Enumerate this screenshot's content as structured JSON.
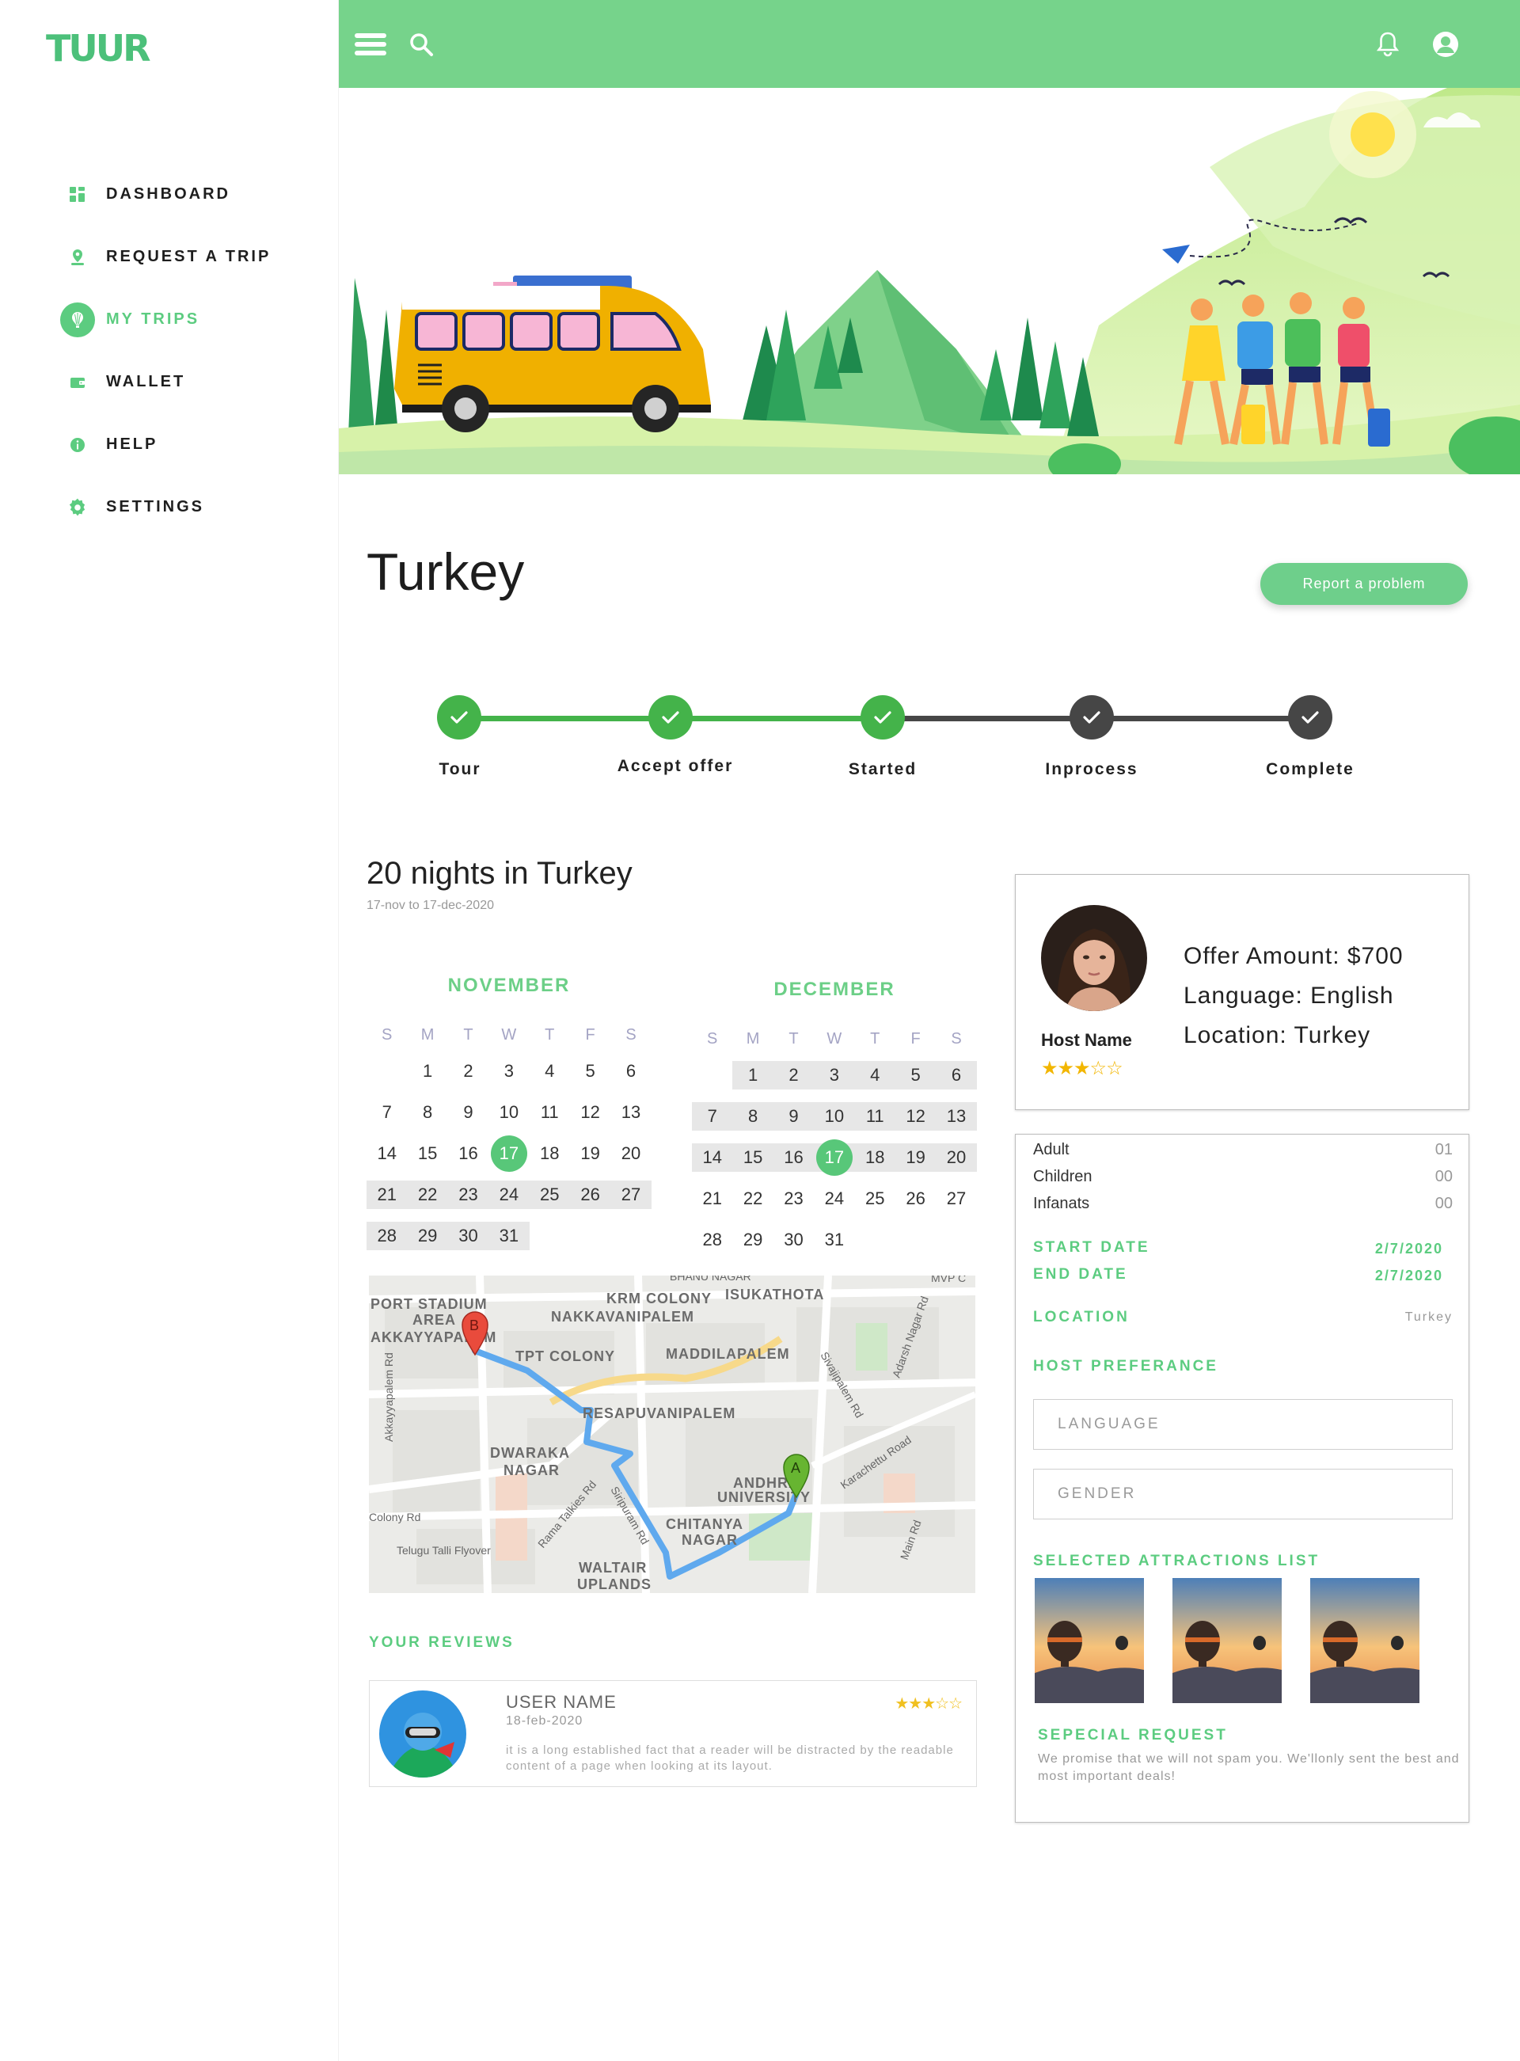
{
  "app": {
    "logo": "TUUR"
  },
  "sidebar": {
    "items": [
      {
        "label": "DASHBOARD",
        "icon": "dashboard-icon",
        "active": false
      },
      {
        "label": "REQUEST A TRIP",
        "icon": "map-pin-icon",
        "active": false
      },
      {
        "label": "MY TRIPS",
        "icon": "balloon-icon",
        "active": true
      },
      {
        "label": "WALLET",
        "icon": "wallet-icon",
        "active": false
      },
      {
        "label": "HELP",
        "icon": "info-icon",
        "active": false
      },
      {
        "label": "SETTINGS",
        "icon": "gear-icon",
        "active": false
      }
    ]
  },
  "topbar": {
    "menu_icon": "hamburger-icon",
    "search_icon": "search-icon",
    "bell_icon": "bell-icon",
    "user_icon": "user-icon"
  },
  "page": {
    "title": "Turkey",
    "report_label": "Report a problem"
  },
  "progress": {
    "steps": [
      {
        "label": "Tour",
        "done": true
      },
      {
        "label": "Accept offer",
        "done": true
      },
      {
        "label": "Started",
        "done": true
      },
      {
        "label": "Inprocess",
        "done": false
      },
      {
        "label": "Complete",
        "done": false
      }
    ]
  },
  "trip": {
    "title": "20 nights in Turkey",
    "dates": "17-nov to 17-dec-2020"
  },
  "calendars": [
    {
      "month": "NOVEMBER",
      "weekdays": [
        "S",
        "M",
        "T",
        "W",
        "T",
        "F",
        "S"
      ],
      "weeks": [
        [
          "",
          "1",
          "2",
          "3",
          "4",
          "5",
          "6"
        ],
        [
          "7",
          "8",
          "9",
          "10",
          "11",
          "12",
          "13"
        ],
        [
          "14",
          "15",
          "16",
          "17",
          "18",
          "19",
          "20"
        ],
        [
          "21",
          "22",
          "23",
          "24",
          "25",
          "26",
          "27"
        ],
        [
          "28",
          "29",
          "30",
          "31",
          "",
          "",
          ""
        ]
      ],
      "selected": "17"
    },
    {
      "month": "DECEMBER",
      "weekdays": [
        "S",
        "M",
        "T",
        "W",
        "T",
        "F",
        "S"
      ],
      "weeks": [
        [
          "",
          "1",
          "2",
          "3",
          "4",
          "5",
          "6"
        ],
        [
          "7",
          "8",
          "9",
          "10",
          "11",
          "12",
          "13"
        ],
        [
          "14",
          "15",
          "16",
          "17",
          "18",
          "19",
          "20"
        ],
        [
          "21",
          "22",
          "23",
          "24",
          "25",
          "26",
          "27"
        ],
        [
          "28",
          "29",
          "30",
          "31",
          "",
          "",
          ""
        ]
      ],
      "selected": "17"
    }
  ],
  "map": {
    "labels": [
      "KRM COLONY",
      "ISUKATHOTA",
      "PORT STADIUM",
      "AREA",
      "AKKAYYAPALEM",
      "NAKKAVANIPALEM",
      "TPT COLONY",
      "MADDILAPALEM",
      "RESAPUVANIPALEM",
      "DWARAKA",
      "NAGAR",
      "ANDHRA",
      "UNIVERSITY",
      "CHITANYA",
      "NAGAR",
      "WALTAIR",
      "UPLANDS",
      "Telugu Talli Flyover",
      "Karachettu Road",
      "Siripuram Rd",
      "Akkayyapalem Rd",
      "Main Rd",
      "Adarsh Nagar Rd",
      "Colony Rd",
      "Rama Talkies Rd",
      "Sivajipalem Rd",
      "BHANU NAGAR",
      "MVP C"
    ],
    "marker_a": "A",
    "marker_b": "B"
  },
  "reviews": {
    "title": "YOUR REVIEWS",
    "items": [
      {
        "name": "USER NAME",
        "date": "18-feb-2020",
        "stars": "★★★☆☆",
        "text": "it is a long established fact that a reader will be distracted by the readable content of a page when looking at its layout."
      }
    ]
  },
  "host": {
    "name": "Host Name",
    "stars": "★★★☆☆",
    "offer": "Offer Amount: $700",
    "language": "Language: English",
    "location": "Location: Turkey"
  },
  "details": {
    "guests": [
      {
        "label": "Adult",
        "value": "01"
      },
      {
        "label": "Children",
        "value": "00"
      },
      {
        "label": "Infanats",
        "value": "00"
      }
    ],
    "start_label": "START DATE",
    "start_value": "2/7/2020",
    "end_label": "END DATE",
    "end_value": "2/7/2020",
    "location_label": "LOCATION",
    "location_value": "Turkey",
    "host_pref_label": "HOST PREFERANCE",
    "language_placeholder": "LANGUAGE",
    "gender_placeholder": "GENDER",
    "attractions_label": "SELECTED ATTRACTIONS LIST",
    "special_label": "SEPECIAL REQUEST",
    "special_text": "We promise that we will not spam you. We'llonly sent the best and most important deals!"
  },
  "colors": {
    "brand": "#76d38b",
    "accent": "#5ccc80",
    "step_done": "#44b34a",
    "step_todo": "#464646"
  }
}
